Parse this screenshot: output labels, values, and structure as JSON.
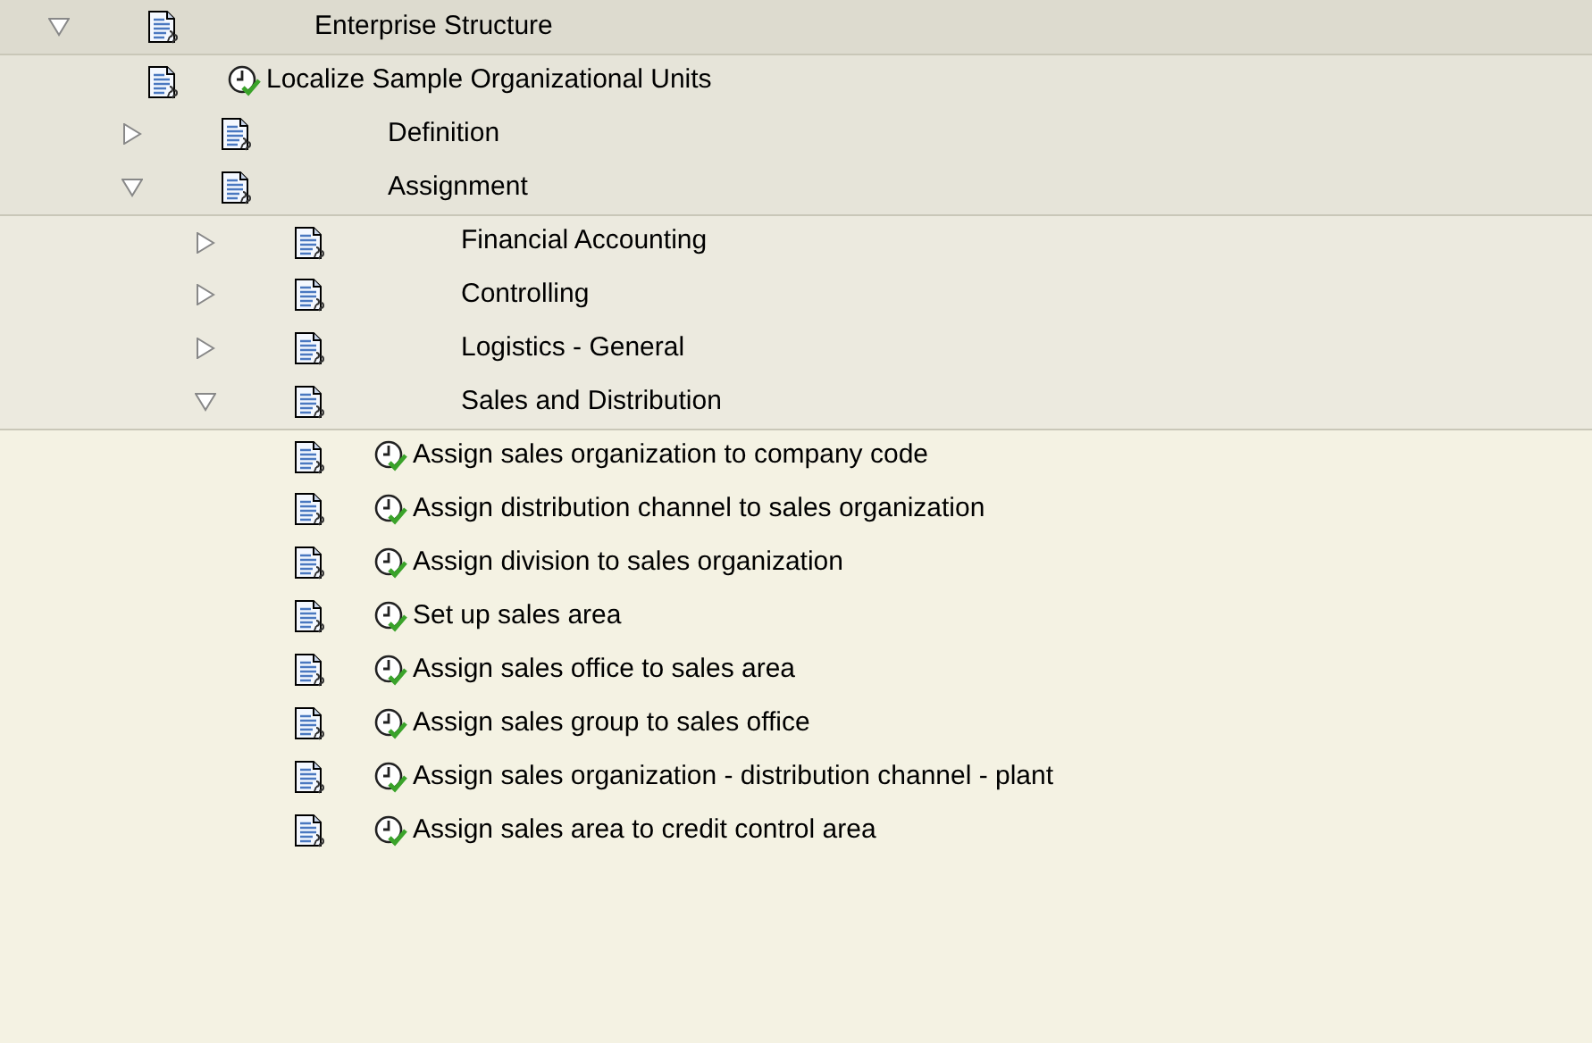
{
  "tree": [
    {
      "kind": "folder",
      "label": "Enterprise Structure",
      "expanded": true,
      "children": [
        {
          "kind": "activity",
          "label": "Localize Sample Organizational Units"
        },
        {
          "kind": "folder",
          "label": "Definition",
          "expanded": false
        },
        {
          "kind": "folder",
          "label": "Assignment",
          "expanded": true,
          "children": [
            {
              "kind": "folder",
              "label": "Financial Accounting",
              "expanded": false
            },
            {
              "kind": "folder",
              "label": "Controlling",
              "expanded": false
            },
            {
              "kind": "folder",
              "label": "Logistics - General",
              "expanded": false
            },
            {
              "kind": "folder",
              "label": "Sales and Distribution",
              "expanded": true,
              "children": [
                {
                  "kind": "activity",
                  "label": "Assign sales organization to company code"
                },
                {
                  "kind": "activity",
                  "label": "Assign distribution channel to sales organization"
                },
                {
                  "kind": "activity",
                  "label": "Assign division to sales organization"
                },
                {
                  "kind": "activity",
                  "label": "Set up sales area"
                },
                {
                  "kind": "activity",
                  "label": "Assign sales office to sales area"
                },
                {
                  "kind": "activity",
                  "label": "Assign sales group to sales office"
                },
                {
                  "kind": "activity",
                  "label": "Assign sales organization - distribution channel - plant"
                },
                {
                  "kind": "activity",
                  "label": "Assign sales area to credit control area"
                }
              ]
            }
          ]
        }
      ]
    }
  ]
}
